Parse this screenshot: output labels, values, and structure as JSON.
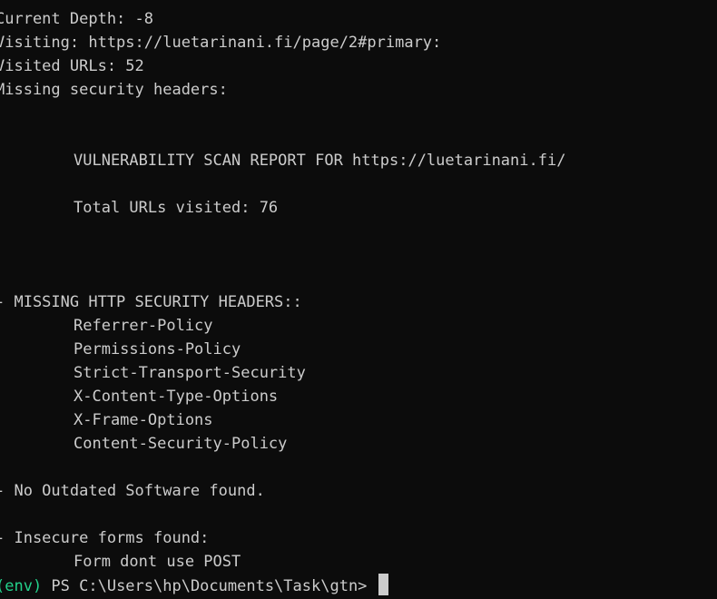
{
  "progress": {
    "current_depth": "Current Depth: -8",
    "visiting": "Visiting: https://luetarinani.fi/page/2#primary:",
    "visited_urls": "Visited URLs: 52",
    "missing_headers_label": "Missing security headers:"
  },
  "report": {
    "title": "VULNERABILITY SCAN REPORT FOR https://luetarinani.fi/",
    "total_urls": "Total URLs visited: 76"
  },
  "missing_headers": {
    "heading": "- MISSING HTTP SECURITY HEADERS::",
    "items": [
      "Referrer-Policy",
      "Permissions-Policy",
      "Strict-Transport-Security",
      "X-Content-Type-Options",
      "X-Frame-Options",
      "Content-Security-Policy"
    ]
  },
  "outdated_software": "- No Outdated Software found.",
  "insecure_forms": {
    "heading": "- Insecure forms found:",
    "item": "Form dont use POST"
  },
  "prompt": {
    "env": "(env)",
    "path": " PS C:\\Users\\hp\\Documents\\Task\\gtn> "
  },
  "colors": {
    "background": "#0c0c0c",
    "text": "#cccccc",
    "env": "#23d18b"
  }
}
